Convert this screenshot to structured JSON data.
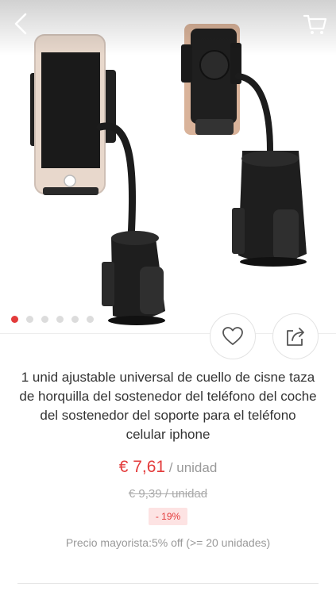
{
  "product": {
    "title": "1 unid ajustable universal de cuello de cisne taza de horquilla del sostenedor del teléfono del coche del sostenedor del soporte para el teléfono celular iphone",
    "price": "€ 7,61",
    "unit": " / unidad",
    "old_price": "€ 9,39  / unidad",
    "discount": "- 19%",
    "wholesale": "Precio mayorista:5% off (>= 20 unidades)"
  },
  "gallery": {
    "image_count": 6,
    "active_index": 0
  },
  "colors": {
    "accent": "#e33b3b",
    "muted": "#999999"
  },
  "icons": {
    "back": "chevron-left-icon",
    "cart": "cart-icon",
    "favorite": "heart-icon",
    "share": "share-icon"
  }
}
